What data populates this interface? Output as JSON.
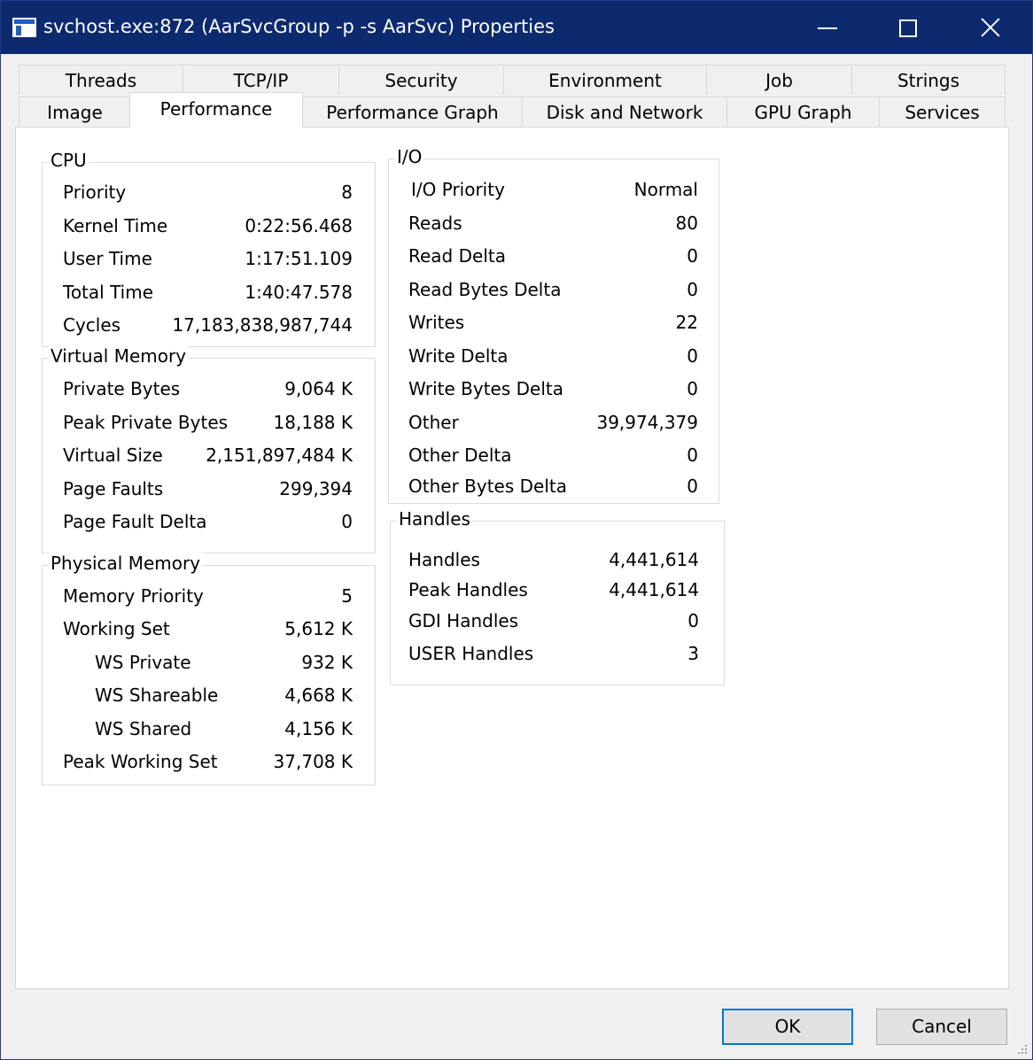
{
  "window": {
    "title": "svchost.exe:872 (AarSvcGroup -p -s AarSvc) Properties"
  },
  "tabs": {
    "row1": [
      "Threads",
      "TCP/IP",
      "Security",
      "Environment",
      "Job",
      "Strings"
    ],
    "row2": [
      "Image",
      "Performance",
      "Performance Graph",
      "Disk and Network",
      "GPU Graph",
      "Services"
    ],
    "active": "Performance"
  },
  "cpu": {
    "title": "CPU",
    "rows": [
      {
        "label": "Priority",
        "value": "8"
      },
      {
        "label": "Kernel Time",
        "value": "0:22:56.468"
      },
      {
        "label": "User Time",
        "value": "1:17:51.109"
      },
      {
        "label": "Total Time",
        "value": "1:40:47.578"
      },
      {
        "label": "Cycles",
        "value": "17,183,838,987,744"
      }
    ]
  },
  "virtual_memory": {
    "title": "Virtual Memory",
    "rows": [
      {
        "label": "Private Bytes",
        "value": "9,064 K"
      },
      {
        "label": "Peak Private Bytes",
        "value": "18,188 K"
      },
      {
        "label": "Virtual Size",
        "value": "2,151,897,484 K"
      },
      {
        "label": "Page Faults",
        "value": "299,394"
      },
      {
        "label": "Page Fault Delta",
        "value": "0"
      }
    ]
  },
  "physical_memory": {
    "title": "Physical Memory",
    "rows": [
      {
        "label": "Memory Priority",
        "value": "5"
      },
      {
        "label": "Working Set",
        "value": "5,612 K"
      },
      {
        "label": "WS Private",
        "value": "932 K"
      },
      {
        "label": "WS Shareable",
        "value": "4,668 K"
      },
      {
        "label": "WS Shared",
        "value": "4,156 K"
      },
      {
        "label": "Peak Working Set",
        "value": "37,708 K"
      }
    ]
  },
  "io": {
    "title": "I/O",
    "rows": [
      {
        "label": "I/O Priority",
        "value": "Normal"
      },
      {
        "label": "Reads",
        "value": "80"
      },
      {
        "label": "Read Delta",
        "value": "0"
      },
      {
        "label": "Read Bytes Delta",
        "value": "0"
      },
      {
        "label": "Writes",
        "value": "22"
      },
      {
        "label": "Write Delta",
        "value": "0"
      },
      {
        "label": "Write Bytes Delta",
        "value": "0"
      },
      {
        "label": "Other",
        "value": "39,974,379"
      },
      {
        "label": "Other Delta",
        "value": "0"
      },
      {
        "label": "Other Bytes Delta",
        "value": "0"
      }
    ]
  },
  "handles": {
    "title": "Handles",
    "rows": [
      {
        "label": "Handles",
        "value": "4,441,614"
      },
      {
        "label": "Peak Handles",
        "value": "4,441,614"
      },
      {
        "label": "GDI Handles",
        "value": "0"
      },
      {
        "label": "USER Handles",
        "value": "3"
      }
    ]
  },
  "buttons": {
    "ok": "OK",
    "cancel": "Cancel"
  },
  "icons": {
    "app": "window-app-icon",
    "minimize": "minimize-icon",
    "maximize": "maximize-icon",
    "close": "close-icon",
    "grip": "resize-grip-icon"
  }
}
